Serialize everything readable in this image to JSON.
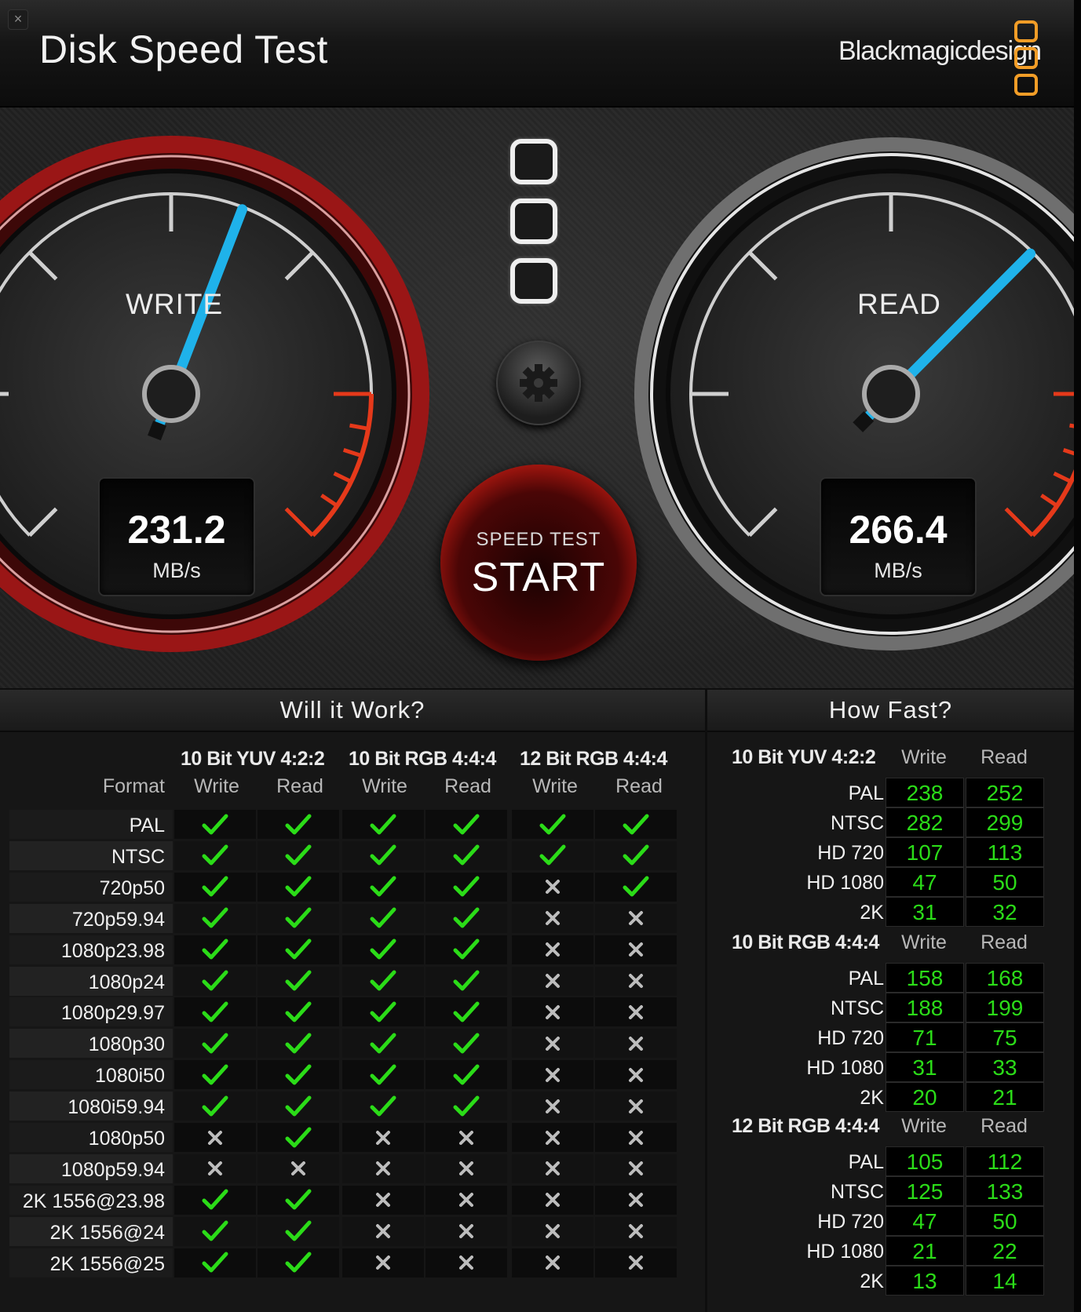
{
  "window": {
    "title": "Disk Speed Test",
    "close_icon": "×",
    "brand": "Blackmagicdesign"
  },
  "colors": {
    "accent_orange": "#f29d27",
    "needle_blue": "#1fb2ea",
    "write_ring_red": "#b01a1a",
    "ok_green": "#2bdc18"
  },
  "gauges": {
    "write": {
      "label": "WRITE",
      "value": "231.2",
      "unit": "MB/s"
    },
    "read": {
      "label": "READ",
      "value": "266.4",
      "unit": "MB/s"
    }
  },
  "start_button": {
    "sub": "SPEED TEST",
    "label": "START"
  },
  "will_it_work": {
    "title": "Will it Work?",
    "format_header": "Format",
    "groups": [
      "10 Bit YUV 4:2:2",
      "10 Bit RGB 4:4:4",
      "12 Bit RGB 4:4:4"
    ],
    "sub_headers": [
      "Write",
      "Read",
      "Write",
      "Read",
      "Write",
      "Read"
    ],
    "rows": [
      {
        "format": "PAL",
        "marks": [
          1,
          1,
          1,
          1,
          1,
          1
        ]
      },
      {
        "format": "NTSC",
        "marks": [
          1,
          1,
          1,
          1,
          1,
          1
        ]
      },
      {
        "format": "720p50",
        "marks": [
          1,
          1,
          1,
          1,
          0,
          1
        ]
      },
      {
        "format": "720p59.94",
        "marks": [
          1,
          1,
          1,
          1,
          0,
          0
        ]
      },
      {
        "format": "1080p23.98",
        "marks": [
          1,
          1,
          1,
          1,
          0,
          0
        ]
      },
      {
        "format": "1080p24",
        "marks": [
          1,
          1,
          1,
          1,
          0,
          0
        ]
      },
      {
        "format": "1080p29.97",
        "marks": [
          1,
          1,
          1,
          1,
          0,
          0
        ]
      },
      {
        "format": "1080p30",
        "marks": [
          1,
          1,
          1,
          1,
          0,
          0
        ]
      },
      {
        "format": "1080i50",
        "marks": [
          1,
          1,
          1,
          1,
          0,
          0
        ]
      },
      {
        "format": "1080i59.94",
        "marks": [
          1,
          1,
          1,
          1,
          0,
          0
        ]
      },
      {
        "format": "1080p50",
        "marks": [
          0,
          1,
          0,
          0,
          0,
          0
        ]
      },
      {
        "format": "1080p59.94",
        "marks": [
          0,
          0,
          0,
          0,
          0,
          0
        ]
      },
      {
        "format": "2K 1556@23.98",
        "marks": [
          1,
          1,
          0,
          0,
          0,
          0
        ]
      },
      {
        "format": "2K 1556@24",
        "marks": [
          1,
          1,
          0,
          0,
          0,
          0
        ]
      },
      {
        "format": "2K 1556@25",
        "marks": [
          1,
          1,
          0,
          0,
          0,
          0
        ]
      }
    ]
  },
  "how_fast": {
    "title": "How Fast?",
    "groups": [
      {
        "name": "10 Bit YUV 4:2:2",
        "write_label": "Write",
        "read_label": "Read",
        "rows": [
          {
            "format": "PAL",
            "write": "238",
            "read": "252"
          },
          {
            "format": "NTSC",
            "write": "282",
            "read": "299"
          },
          {
            "format": "HD 720",
            "write": "107",
            "read": "113"
          },
          {
            "format": "HD 1080",
            "write": "47",
            "read": "50"
          },
          {
            "format": "2K",
            "write": "31",
            "read": "32"
          }
        ]
      },
      {
        "name": "10 Bit RGB 4:4:4",
        "write_label": "Write",
        "read_label": "Read",
        "rows": [
          {
            "format": "PAL",
            "write": "158",
            "read": "168"
          },
          {
            "format": "NTSC",
            "write": "188",
            "read": "199"
          },
          {
            "format": "HD 720",
            "write": "71",
            "read": "75"
          },
          {
            "format": "HD 1080",
            "write": "31",
            "read": "33"
          },
          {
            "format": "2K",
            "write": "20",
            "read": "21"
          }
        ]
      },
      {
        "name": "12 Bit RGB 4:4:4",
        "write_label": "Write",
        "read_label": "Read",
        "rows": [
          {
            "format": "PAL",
            "write": "105",
            "read": "112"
          },
          {
            "format": "NTSC",
            "write": "125",
            "read": "133"
          },
          {
            "format": "HD 720",
            "write": "47",
            "read": "50"
          },
          {
            "format": "HD 1080",
            "write": "21",
            "read": "22"
          },
          {
            "format": "2K",
            "write": "13",
            "read": "14"
          }
        ]
      }
    ]
  }
}
